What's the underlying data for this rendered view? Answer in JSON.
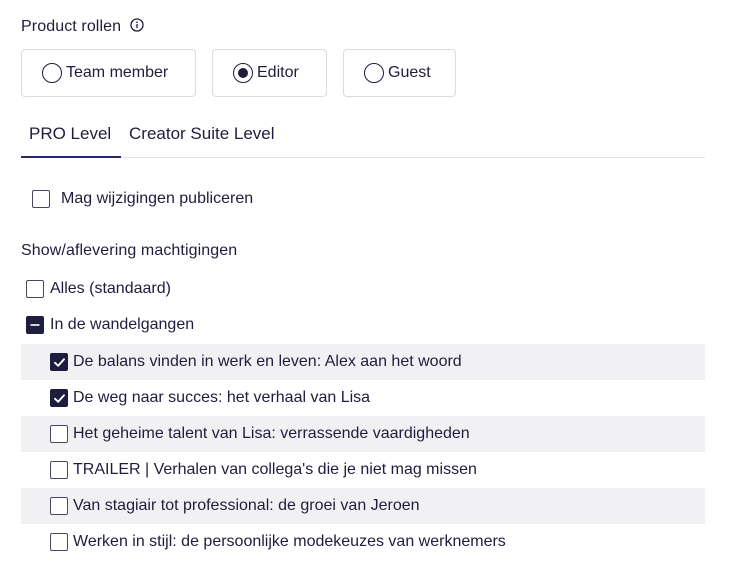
{
  "roles_section": {
    "label": "Product rollen",
    "info_icon": "info-icon",
    "options": [
      {
        "label": "Team member",
        "selected": false
      },
      {
        "label": "Editor",
        "selected": true
      },
      {
        "label": "Guest",
        "selected": false
      }
    ]
  },
  "tabs": [
    {
      "label": "PRO Level",
      "active": true
    },
    {
      "label": "Creator Suite Level",
      "active": false
    }
  ],
  "publish": {
    "label": "Mag wijzigingen publiceren",
    "checked": false
  },
  "permissions": {
    "label": "Show/aflevering machtigingen",
    "all_default": {
      "label": "Alles (standaard)",
      "checked": false
    },
    "group": {
      "label": "In de wandelgangen",
      "state": "partial"
    },
    "episodes": [
      {
        "label": "De balans vinden in werk en leven: Alex aan het woord",
        "checked": true
      },
      {
        "label": "De weg naar succes: het verhaal van Lisa",
        "checked": true
      },
      {
        "label": "Het geheime talent van Lisa: verrassende vaardigheden",
        "checked": false
      },
      {
        "label": "TRAILER | Verhalen van collega's die je niet mag missen",
        "checked": false
      },
      {
        "label": "Van stagiair tot professional: de groei van Jeroen",
        "checked": false
      },
      {
        "label": "Werken in stijl: de persoonlijke modekeuzes van werknemers",
        "checked": false
      }
    ]
  },
  "colors": {
    "text": "#1f1d3d",
    "accent": "#2b2775",
    "row_shade": "#f1f1f3",
    "border": "#dcdbe4"
  }
}
